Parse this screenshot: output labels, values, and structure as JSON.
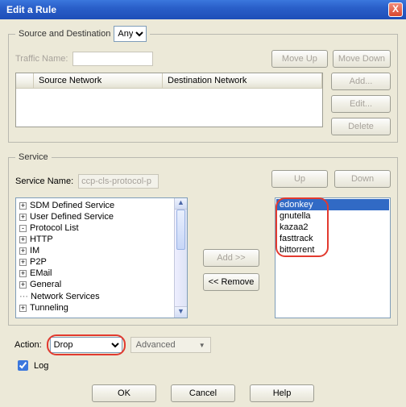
{
  "window": {
    "title": "Edit a Rule",
    "close": "X"
  },
  "srcDest": {
    "legend": "Source and Destination",
    "scope_selected": "Any",
    "scope_options": [
      "Any"
    ],
    "traffic_label": "Traffic Name:",
    "move_up": "Move Up",
    "move_down": "Move Down",
    "col_source": "Source Network",
    "col_dest": "Destination Network",
    "btn_add": "Add...",
    "btn_edit": "Edit...",
    "btn_delete": "Delete"
  },
  "service": {
    "legend": "Service",
    "name_label": "Service Name:",
    "name_value": "ccp-cls-protocol-p",
    "btn_up": "Up",
    "btn_down": "Down",
    "btn_add": "Add >>",
    "btn_remove": "<< Remove",
    "tree": {
      "sdm": "SDM Defined Service",
      "user": "User Defined Service",
      "protocol": "Protocol List",
      "http": "HTTP",
      "im": "IM",
      "p2p": "P2P",
      "email": "EMail",
      "general": "General",
      "netsvc": "Network Services",
      "tunneling": "Tunneling"
    },
    "selected_items": [
      "edonkey",
      "gnutella",
      "kazaa2",
      "fasttrack",
      "bittorrent"
    ]
  },
  "action": {
    "label": "Action:",
    "selected": "Drop",
    "options": [
      "Drop"
    ],
    "advanced": "Advanced",
    "log": "Log"
  },
  "footer": {
    "ok": "OK",
    "cancel": "Cancel",
    "help": "Help"
  }
}
